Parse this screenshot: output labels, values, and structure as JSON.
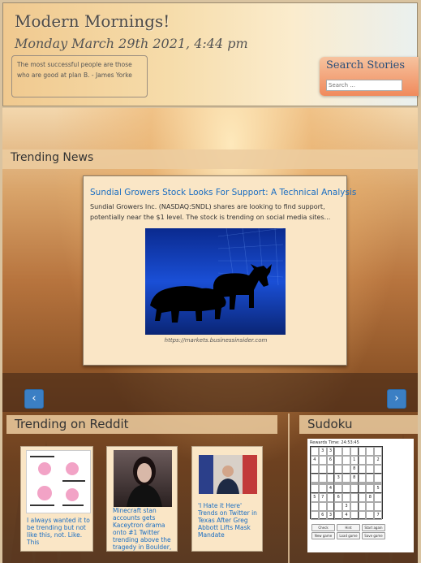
{
  "header": {
    "title": "Modern Mornings!",
    "date": "Monday March 29th 2021, 4:44 pm",
    "quote": "The most successful people are those who are good at plan B. - James Yorke",
    "search_title": "Search Stories",
    "search_placeholder": "Search ..."
  },
  "trending_news": {
    "section_title": "Trending News",
    "article_title": "Sundial Growers Stock Looks For Support: A Technical Analysis",
    "article_desc": "Sundial Growers Inc. (NASDAQ:SNDL) shares are looking to find support, potentially near the $1 level. The stock is trending on social media sites...",
    "article_source": "https://markets.businessinsider.com",
    "prev_icon": "chevron-left-icon",
    "next_icon": "chevron-right-icon",
    "prev_glyph": "‹",
    "next_glyph": "›"
  },
  "reddit": {
    "section_title": "Trending on Reddit",
    "posts": [
      {
        "title": "I always wanted it to be trending but not like this, not. Like. This"
      },
      {
        "title": "Minecraft stan accounts gets Kaceytron drama onto #1 Twitter trending above the tragedy in Boulder, Colorado today"
      },
      {
        "title": "'I Hate it Here' Trends on Twitter in Texas After Greg Abbott Lifts Mask Mandate"
      }
    ]
  },
  "sudoku": {
    "section_title": "Sudoku",
    "header_text": "Rewards   Time: 24:53:45",
    "buttons": [
      "Check",
      "Hint",
      "Start again",
      "New game",
      "Load game",
      "Save game"
    ],
    "cells": [
      [
        "",
        "3",
        "3",
        "",
        "",
        "",
        "",
        "",
        ""
      ],
      [
        "4",
        "",
        "6",
        "",
        "",
        "1",
        "",
        "",
        "2"
      ],
      [
        "",
        "",
        "",
        "",
        "",
        "8",
        "",
        "",
        ""
      ],
      [
        "",
        "",
        "",
        "3",
        "",
        "8",
        "",
        "",
        ""
      ],
      [
        "",
        "",
        "",
        "",
        "",
        "",
        "",
        "",
        ""
      ],
      [
        "",
        "",
        "4",
        "",
        "",
        "",
        "",
        "",
        "5"
      ],
      [
        "5",
        "7",
        "",
        "6",
        "",
        "",
        "",
        "8",
        ""
      ],
      [
        "",
        "",
        "",
        "",
        "3",
        "",
        "",
        "",
        ""
      ],
      [
        "",
        "6",
        "3",
        "",
        "4",
        "",
        "",
        "",
        "7"
      ]
    ]
  }
}
